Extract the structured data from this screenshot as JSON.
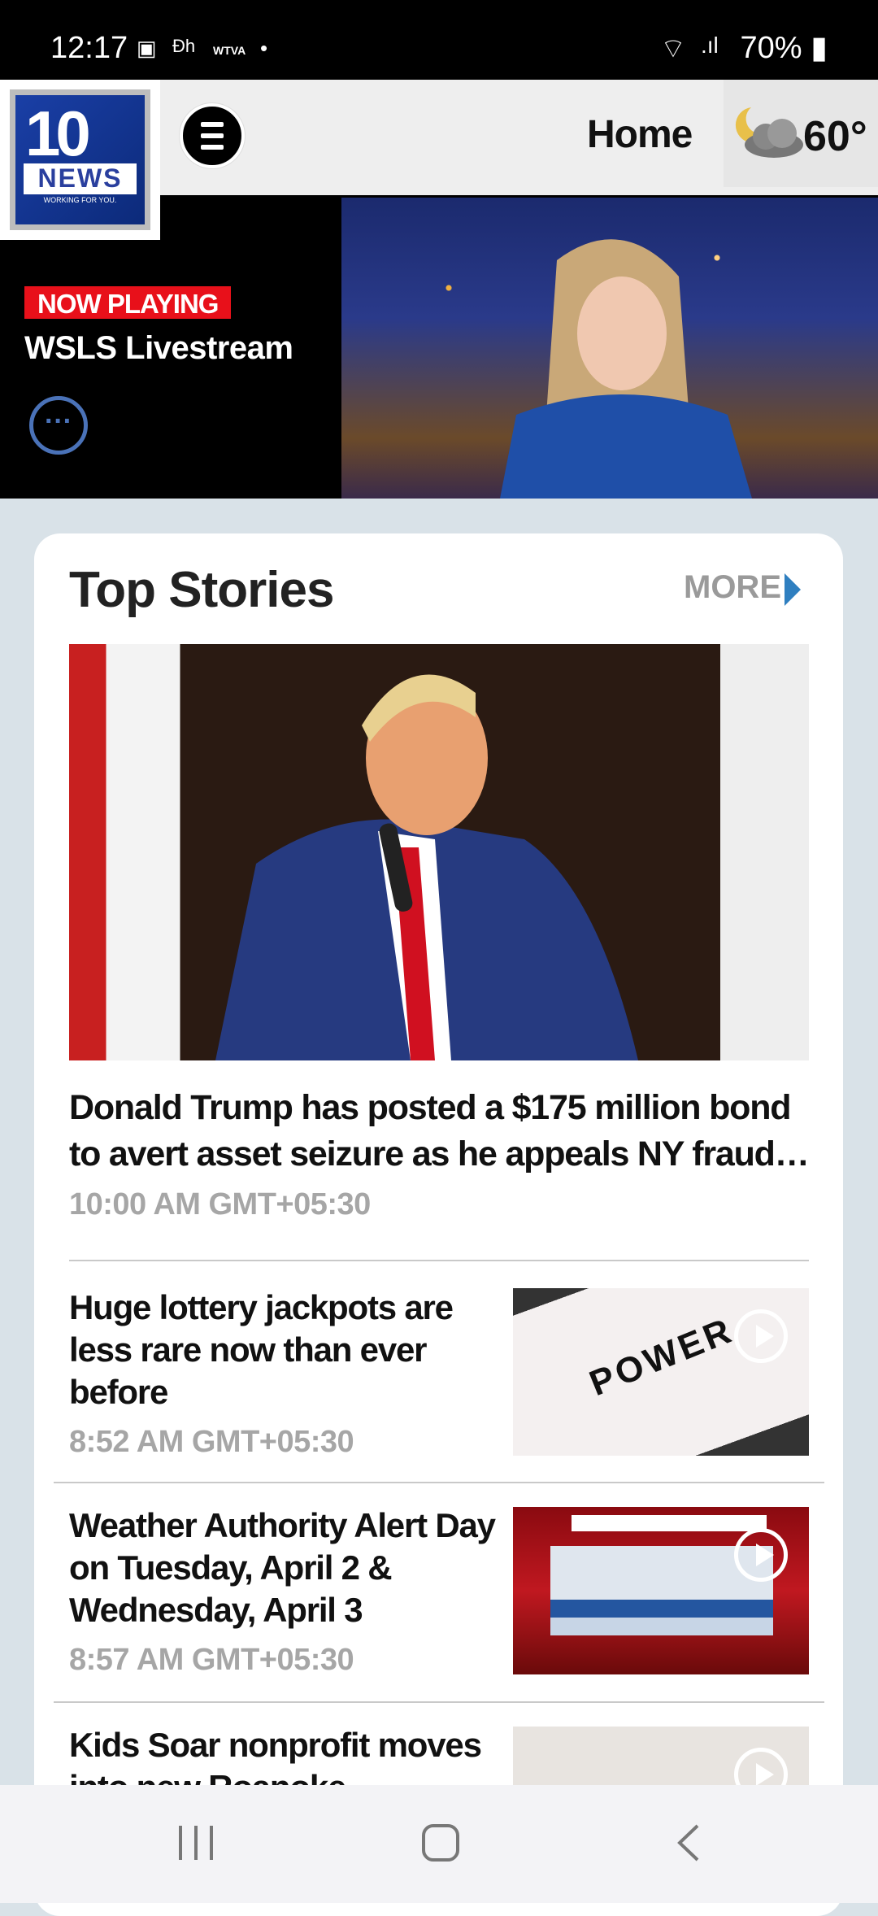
{
  "status_bar": {
    "time": "12:17",
    "notif_icons": [
      "image-icon",
      "dh-icon",
      "wtva-icon",
      "dot-icon"
    ],
    "battery": "70%"
  },
  "header": {
    "logo": {
      "number": "10",
      "word": "NEWS",
      "tagline": "WORKING FOR YOU."
    },
    "title": "Home",
    "weather": {
      "icon": "partly-cloudy-night-icon",
      "temp": "60°"
    }
  },
  "live": {
    "badge": "NOW PLAYING",
    "title": "WSLS Livestream"
  },
  "top_stories": {
    "title": "Top Stories",
    "more_label": "MORE",
    "hero": {
      "headline": "Donald Trump has posted a $175 million bond to avert asset seizure as he appeals NY fraud case",
      "time": "10:00 AM GMT+05:30"
    },
    "items": [
      {
        "headline": "Huge lottery jackpots are less rare now than ever before",
        "time": "8:52 AM GMT+05:30",
        "video": true
      },
      {
        "headline": "Weather Authority Alert Day on Tuesday, April 2 & Wednesday, April 3",
        "time": "8:57 AM GMT+05:30",
        "video": true
      },
      {
        "headline": "Kids Soar nonprofit moves into new Roanoke",
        "time": "",
        "video": true
      }
    ]
  },
  "colors": {
    "accent_red": "#e8101a",
    "more_arrow": "#2f7fc0",
    "background": "#d9e2e8"
  }
}
